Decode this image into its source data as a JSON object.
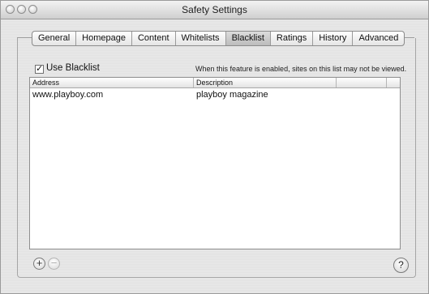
{
  "window": {
    "title": "Safety Settings"
  },
  "tabs": [
    {
      "label": "General"
    },
    {
      "label": "Homepage"
    },
    {
      "label": "Content"
    },
    {
      "label": "Whitelists"
    },
    {
      "label": "Blacklist",
      "selected": true
    },
    {
      "label": "Ratings"
    },
    {
      "label": "History"
    },
    {
      "label": "Advanced"
    }
  ],
  "blacklist": {
    "use_checkbox_label": "Use Blacklist",
    "use_checkbox_checked": true,
    "checkmark": "✓",
    "hint": "When this feature is enabled, sites on this list may not be viewed.",
    "columns": {
      "address": "Address",
      "description": "Description"
    },
    "rows": [
      {
        "address": "www.playboy.com",
        "description": "playboy magazine"
      }
    ]
  },
  "controls": {
    "add_symbol": "+",
    "remove_symbol": "−",
    "help_symbol": "?"
  }
}
